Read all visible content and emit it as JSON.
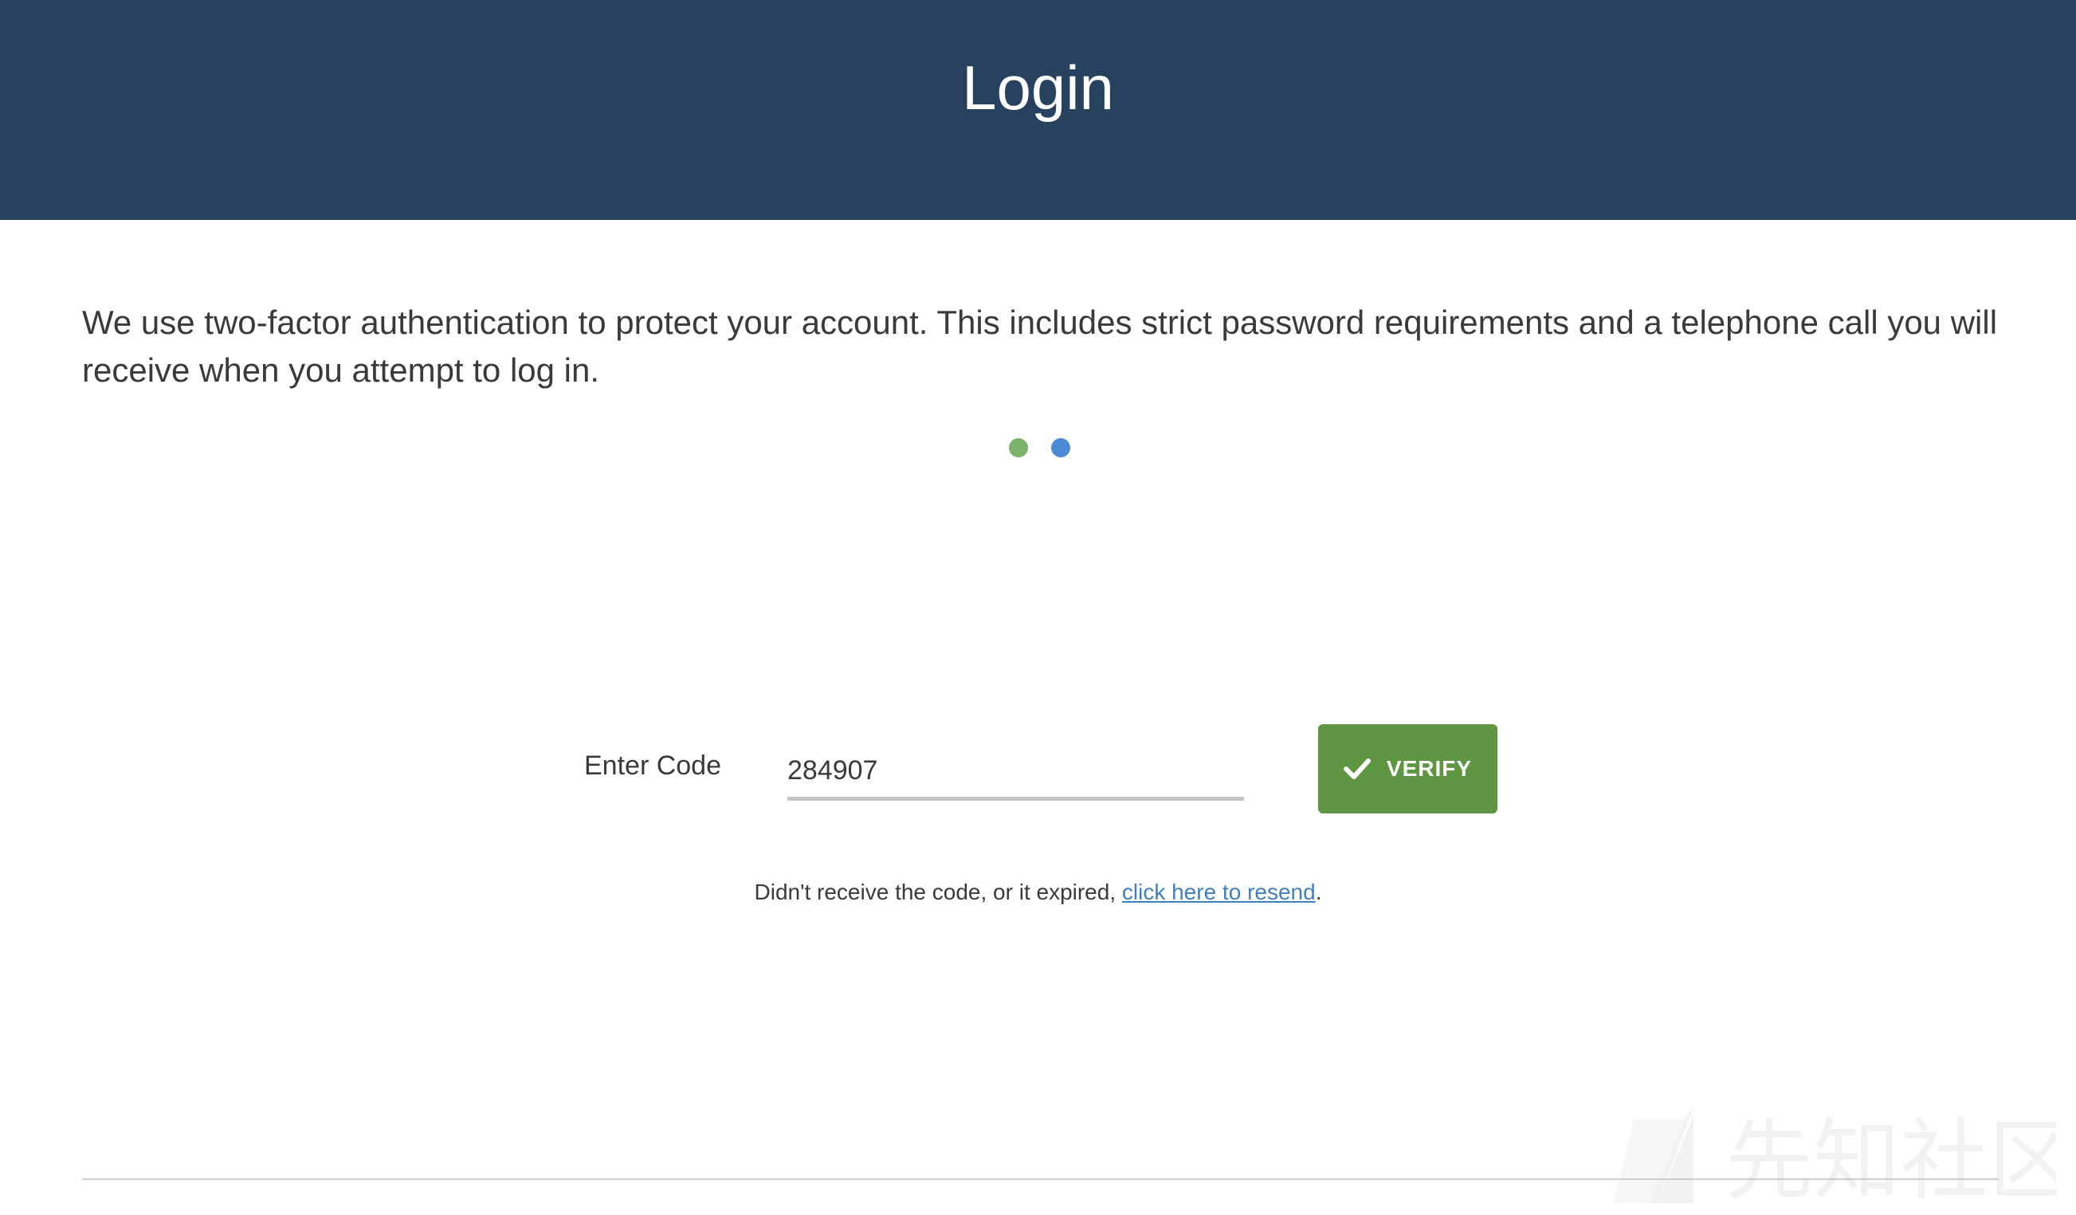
{
  "header": {
    "title": "Login"
  },
  "intro": {
    "text": "We use two-factor authentication to protect your account. This includes strict password requirements and a telephone call you will receive when you attempt to log in."
  },
  "steps": {
    "dots": [
      {
        "name": "step-1",
        "color": "#7cb36c"
      },
      {
        "name": "step-2",
        "color": "#4a8ad6"
      }
    ]
  },
  "code_form": {
    "label": "Enter Code",
    "value": "284907",
    "verify_label": "VERIFY",
    "verify_icon": "check-icon",
    "verify_color": "#5e9642"
  },
  "resend": {
    "prefix": "Didn't receive the code, or it expired, ",
    "link_text": "click here to resend",
    "suffix": "."
  },
  "watermark": {
    "text": "先知社区"
  },
  "colors": {
    "header_bg": "#27425e",
    "link": "#3f7fc0"
  }
}
